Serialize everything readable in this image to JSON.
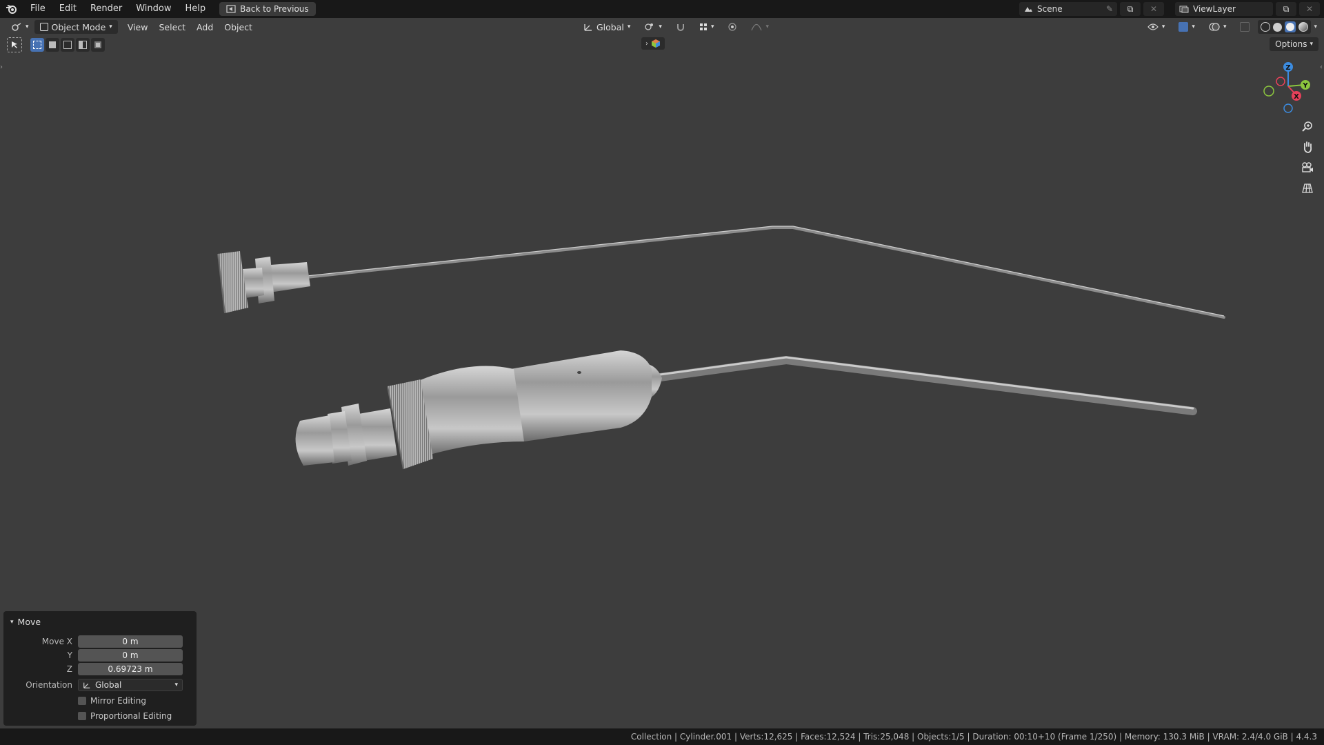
{
  "topbar": {
    "menus": [
      "File",
      "Edit",
      "Render",
      "Window",
      "Help"
    ],
    "back_button": "Back to Previous",
    "scene": "Scene",
    "view_layer": "ViewLayer"
  },
  "viewport_header": {
    "mode": "Object Mode",
    "menus": [
      "View",
      "Select",
      "Add",
      "Object"
    ],
    "transform_orientation": "Global",
    "options": "Options"
  },
  "gizmo": {
    "z": "Z",
    "y": "Y",
    "x": "X"
  },
  "operator_panel": {
    "title": "Move",
    "move_x_label": "Move X",
    "move_x": "0 m",
    "y_label": "Y",
    "y": "0 m",
    "z_label": "Z",
    "z": "0.69723 m",
    "orientation_label": "Orientation",
    "orientation": "Global",
    "mirror_editing": "Mirror Editing",
    "proportional_editing": "Proportional Editing"
  },
  "statusbar": {
    "text": "Collection | Cylinder.001 | Verts:12,625 | Faces:12,524 | Tris:25,048 | Objects:1/5 | Duration: 00:10+10 (Frame 1/250) | Memory: 130.3 MiB | VRAM: 2.4/4.0 GiB | 4.4.3"
  },
  "colors": {
    "viewport_bg": "#3d3d3d",
    "ui_bg": "#181818",
    "accent": "#4772b3",
    "axis_x": "#e8405a",
    "axis_y": "#8cc63e",
    "axis_z": "#3c8ce0"
  }
}
